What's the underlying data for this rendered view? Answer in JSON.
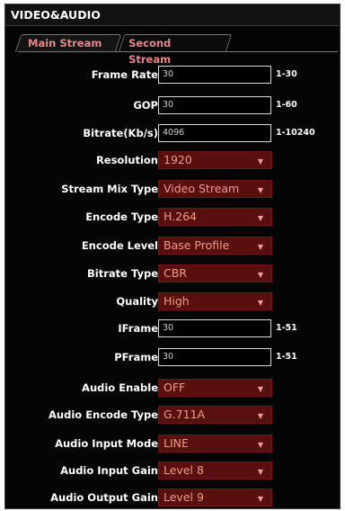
{
  "panel": {
    "title": "VIDEO&AUDIO"
  },
  "tabs": [
    {
      "label": "Main Stream",
      "active": true
    },
    {
      "label": "Second Stream",
      "active": false
    }
  ],
  "fields": {
    "frame_rate": {
      "label": "Frame Rate",
      "value": "30",
      "range": "1-30"
    },
    "gop": {
      "label": "GOP",
      "value": "30",
      "range": "1-60"
    },
    "bitrate": {
      "label": "Bitrate(Kb/s)",
      "value": "4096",
      "range": "1-10240"
    },
    "resolution": {
      "label": "Resolution",
      "value": "1920"
    },
    "stream_mix_type": {
      "label": "Stream Mix Type",
      "value": "Video Stream"
    },
    "encode_type": {
      "label": "Encode Type",
      "value": "H.264"
    },
    "encode_level": {
      "label": "Encode Level",
      "value": "Base Profile"
    },
    "bitrate_type": {
      "label": "Bitrate Type",
      "value": "CBR"
    },
    "quality": {
      "label": "Quality",
      "value": "High"
    },
    "iframe": {
      "label": "IFrame",
      "value": "30",
      "range": "1-51"
    },
    "pframe": {
      "label": "PFrame",
      "value": "30",
      "range": "1-51"
    },
    "audio_enable": {
      "label": "Audio Enable",
      "value": "OFF"
    },
    "audio_encode_type": {
      "label": "Audio Encode Type",
      "value": "G.711A"
    },
    "audio_input_mode": {
      "label": "Audio Input Mode",
      "value": "LINE"
    },
    "audio_input_gain": {
      "label": "Audio Input Gain",
      "value": "Level 8"
    },
    "audio_output_gain": {
      "label": "Audio Output Gain",
      "value": "Level 9"
    }
  },
  "dropdown_icon": "caret-down-icon",
  "colors": {
    "background": "#050505",
    "select_bg": "#5a0f0f",
    "select_text": "#ee9a86",
    "tab_text": "#e08a8a"
  }
}
